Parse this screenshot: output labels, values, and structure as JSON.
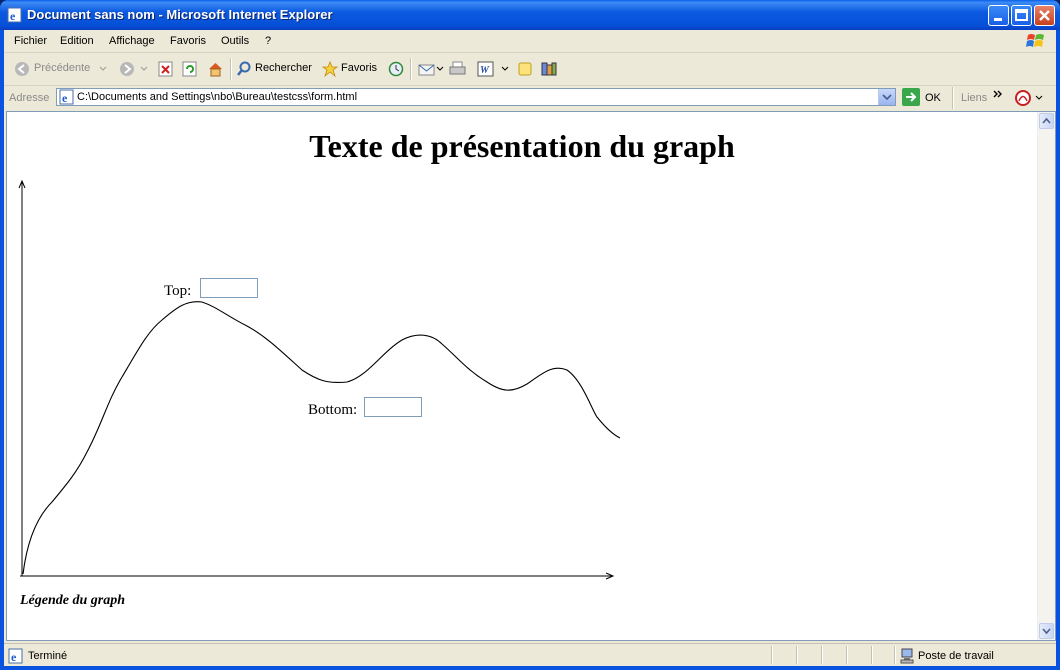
{
  "window": {
    "title": "Document sans nom - Microsoft Internet Explorer"
  },
  "menu": [
    "Fichier",
    "Edition",
    "Affichage",
    "Favoris",
    "Outils",
    "?"
  ],
  "toolbar": {
    "back_label": "Précédente",
    "search_label": "Rechercher",
    "favorites_label": "Favoris"
  },
  "address": {
    "label": "Adresse",
    "url": "C:\\Documents and Settings\\nbo\\Bureau\\testcss\\form.html",
    "go_label": "OK",
    "links_label": "Liens"
  },
  "page": {
    "heading": "Texte de présentation du graph",
    "top_label": "Top:",
    "top_value": "",
    "bottom_label": "Bottom:",
    "bottom_value": "",
    "caption": "Légende du graph"
  },
  "status": {
    "text": "Terminé",
    "zone": "Poste de travail"
  }
}
